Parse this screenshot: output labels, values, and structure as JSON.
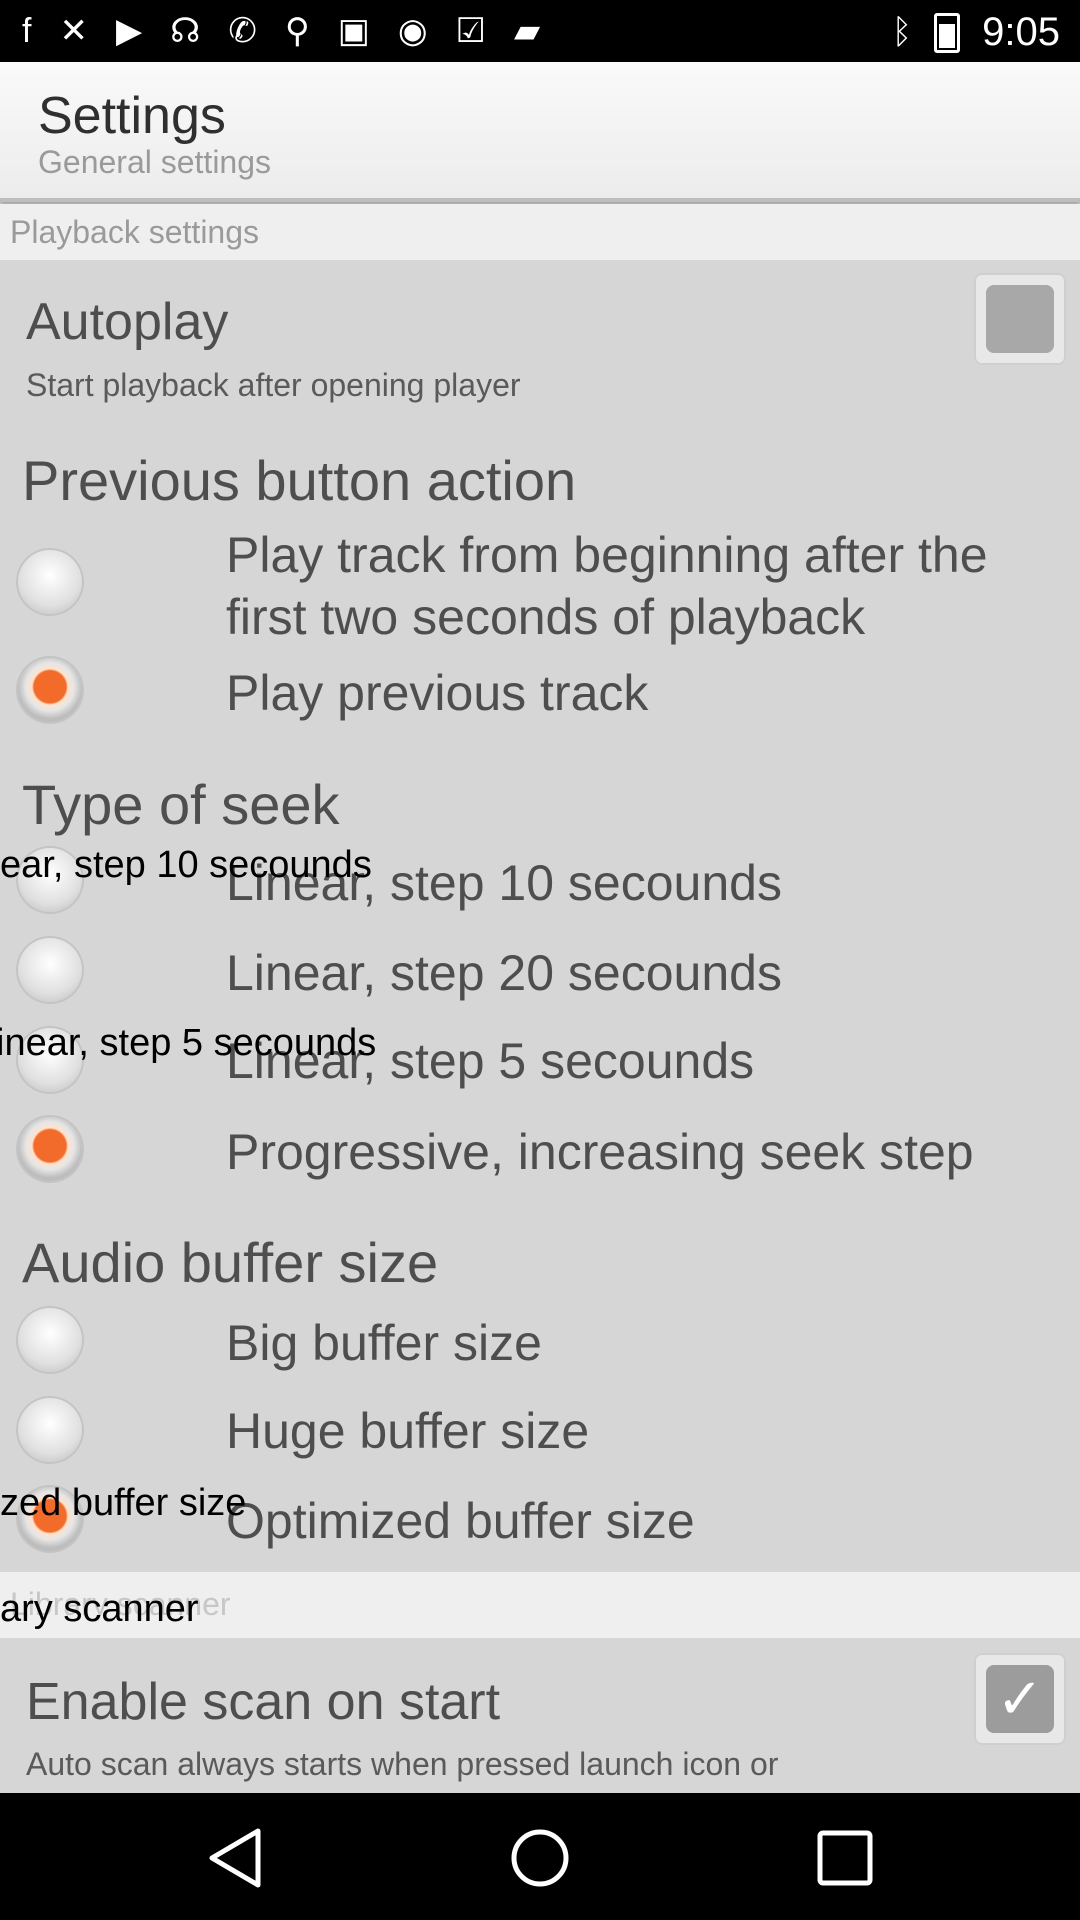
{
  "status_bar": {
    "time": "9:05",
    "left_icons": [
      "facebook-icon",
      "tools-icon",
      "play-circle-icon",
      "radio-icon",
      "phone-icon",
      "satellite-icon",
      "lock-icon",
      "robot-icon",
      "check-tray-icon",
      "briefcase-icon"
    ],
    "right_icons": [
      "bluetooth-icon",
      "battery-icon"
    ]
  },
  "header": {
    "title": "Settings",
    "subtitle": "General settings"
  },
  "sections": {
    "playback": "Playback settings",
    "library": "Library scanner"
  },
  "autoplay": {
    "title": "Autoplay",
    "summary": "Start playback after opening player",
    "checked": false
  },
  "previous_action": {
    "title": "Previous button action",
    "options": [
      {
        "label": "Play track from beginning after the first two seconds of playback",
        "selected": false
      },
      {
        "label": "Play previous track",
        "selected": true
      }
    ]
  },
  "seek": {
    "title": "Type of seek",
    "options": [
      {
        "label": "Linear, step 10 secounds",
        "selected": false
      },
      {
        "label": "Linear, step 20 secounds",
        "selected": false
      },
      {
        "label": "Linear, step 5 secounds",
        "selected": false
      },
      {
        "label": "Progressive, increasing seek step",
        "selected": true
      }
    ]
  },
  "buffer": {
    "title": "Audio buffer size",
    "options": [
      {
        "label": "Big buffer size",
        "selected": false
      },
      {
        "label": "Huge buffer size",
        "selected": false
      },
      {
        "label": "Optimized buffer size",
        "selected": true
      }
    ]
  },
  "scan": {
    "title": "Enable scan on start",
    "summary": "Auto scan always starts when pressed launch icon or",
    "checked": true
  },
  "overlays": {
    "seek10": "ear, step 10 secounds",
    "seek5": "inear, step 5 secounds",
    "buffer": "zed buffer size",
    "library": "ary scanner"
  },
  "nav": {
    "back": "back-icon",
    "home": "home-icon",
    "recents": "recents-icon"
  }
}
